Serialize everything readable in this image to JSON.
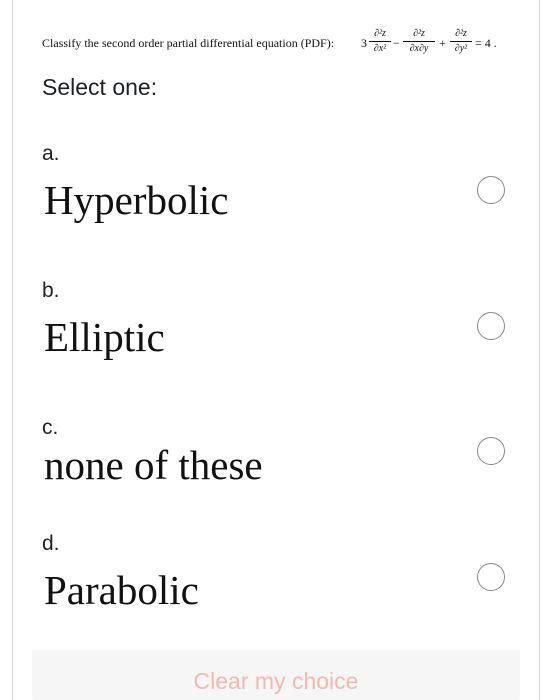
{
  "question": {
    "prefix": "Classify the second order partial differential equation (PDF):",
    "equation": {
      "coefficient": "3",
      "term1": {
        "num": "∂²z",
        "den": "∂x²"
      },
      "op1": "−",
      "term2": {
        "num": "∂²z",
        "den": "∂x∂y"
      },
      "op2": "+",
      "term3": {
        "num": "∂²z",
        "den": "∂y²"
      },
      "rhs": "= 4 ."
    }
  },
  "prompt": "Select one:",
  "options": [
    {
      "letter": "a.",
      "text": "Hyperbolic",
      "selected": false
    },
    {
      "letter": "b.",
      "text": "Elliptic",
      "selected": false
    },
    {
      "letter": "c.",
      "text": "none of these",
      "selected": false
    },
    {
      "letter": "d.",
      "text": "Parabolic",
      "selected": false
    }
  ],
  "clear_choice": "Clear my choice",
  "colors": {
    "clear_link": "#f2b8b0",
    "radio_border": "#8a8a8a",
    "clear_bar": "#f6f6f7"
  }
}
